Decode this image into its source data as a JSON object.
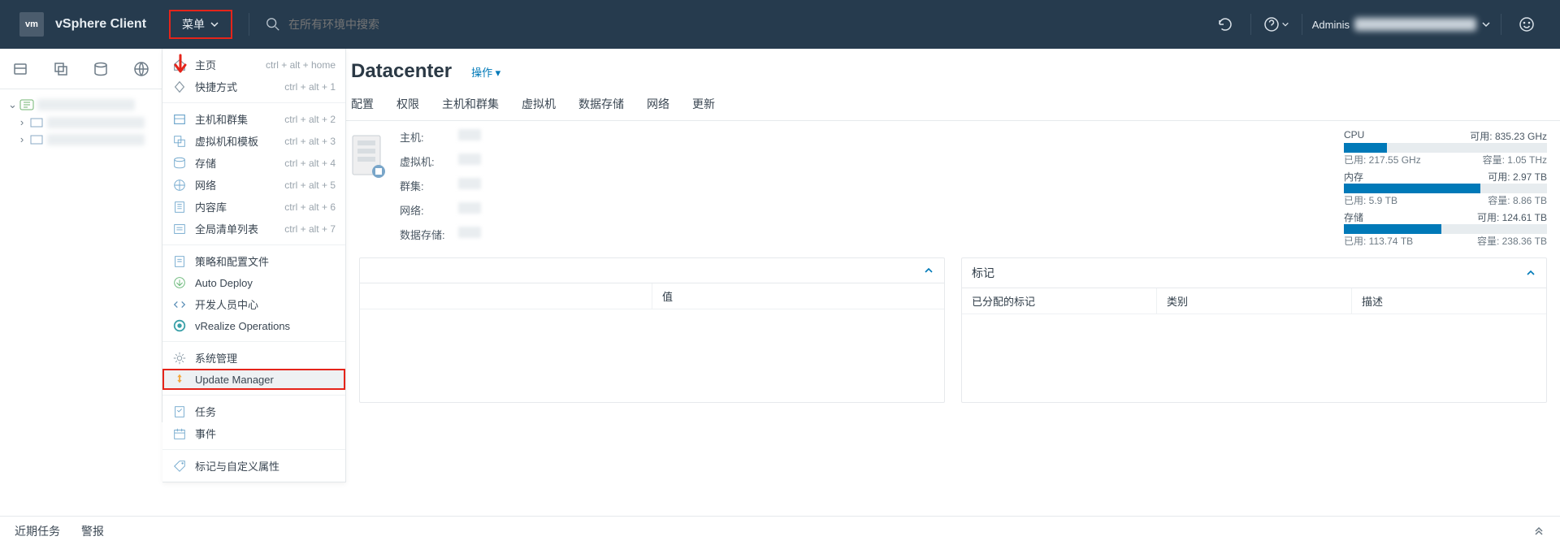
{
  "topbar": {
    "logo": "vm",
    "product": "vSphere Client",
    "menu_label": "菜单",
    "search_placeholder": "在所有环境中搜索",
    "user_label": "Adminis"
  },
  "dropdown": {
    "sections": [
      [
        {
          "icon": "home",
          "label": "主页",
          "shortcut": "ctrl + alt + home"
        },
        {
          "icon": "diamond",
          "label": "快捷方式",
          "shortcut": "ctrl + alt + 1"
        }
      ],
      [
        {
          "icon": "hosts",
          "label": "主机和群集",
          "shortcut": "ctrl + alt + 2"
        },
        {
          "icon": "vmtpl",
          "label": "虚拟机和模板",
          "shortcut": "ctrl + alt + 3"
        },
        {
          "icon": "storage",
          "label": "存储",
          "shortcut": "ctrl + alt + 4"
        },
        {
          "icon": "network",
          "label": "网络",
          "shortcut": "ctrl + alt + 5"
        },
        {
          "icon": "library",
          "label": "内容库",
          "shortcut": "ctrl + alt + 6"
        },
        {
          "icon": "list",
          "label": "全局清单列表",
          "shortcut": "ctrl + alt + 7"
        }
      ],
      [
        {
          "icon": "policy",
          "label": "策略和配置文件",
          "shortcut": ""
        },
        {
          "icon": "deploy",
          "label": "Auto Deploy",
          "shortcut": ""
        },
        {
          "icon": "dev",
          "label": "开发人员中心",
          "shortcut": ""
        },
        {
          "icon": "vrops",
          "label": "vRealize Operations",
          "shortcut": ""
        }
      ],
      [
        {
          "icon": "admin",
          "label": "系统管理",
          "shortcut": ""
        },
        {
          "icon": "update",
          "label": "Update Manager",
          "shortcut": "",
          "hl": true
        }
      ],
      [
        {
          "icon": "tasks",
          "label": "任务",
          "shortcut": ""
        },
        {
          "icon": "events",
          "label": "事件",
          "shortcut": ""
        }
      ],
      [
        {
          "icon": "tags",
          "label": "标记与自定义属性",
          "shortcut": ""
        }
      ]
    ]
  },
  "page": {
    "title": "Datacenter",
    "actions": "操作 ▾"
  },
  "tabs": [
    "配置",
    "权限",
    "主机和群集",
    "虚拟机",
    "数据存储",
    "网络",
    "更新"
  ],
  "summary_labels": {
    "hosts": "主机:",
    "vms": "虚拟机:",
    "clusters": "群集:",
    "networks": "网络:",
    "datastores": "数据存储:"
  },
  "meters": [
    {
      "name": "CPU",
      "avail_label": "可用:",
      "avail": "835.23 GHz",
      "used_label": "已用:",
      "used": "217.55 GHz",
      "cap_label": "容量:",
      "cap": "1.05 THz",
      "pct": 21
    },
    {
      "name": "内存",
      "avail_label": "可用:",
      "avail": "2.97 TB",
      "used_label": "已用:",
      "used": "5.9 TB",
      "cap_label": "容量:",
      "cap": "8.86 TB",
      "pct": 67
    },
    {
      "name": "存储",
      "avail_label": "可用:",
      "avail": "124.61 TB",
      "used_label": "已用:",
      "used": "113.74 TB",
      "cap_label": "容量:",
      "cap": "238.36 TB",
      "pct": 48
    }
  ],
  "panels": {
    "left": {
      "title": "",
      "cols": [
        "",
        "值"
      ]
    },
    "right": {
      "title": "标记",
      "cols": [
        "已分配的标记",
        "类别",
        "描述"
      ]
    }
  },
  "bottom": {
    "recent": "近期任务",
    "alarms": "警报"
  }
}
